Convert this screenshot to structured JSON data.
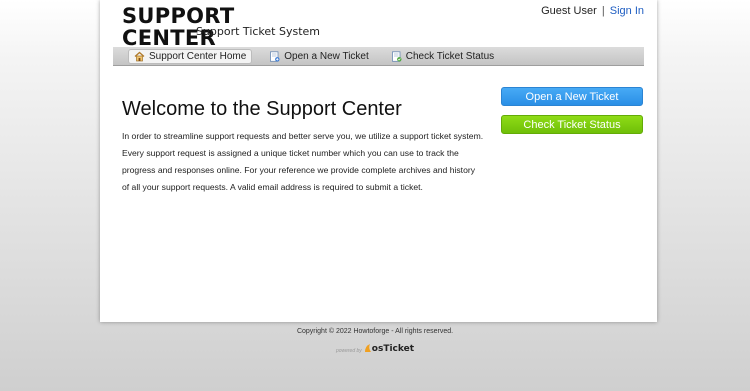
{
  "header": {
    "logo_title": "SUPPORT CENTER",
    "logo_subtitle": "Support Ticket System",
    "user_label": "Guest User",
    "separator": "|",
    "signin_label": "Sign In"
  },
  "nav": {
    "items": [
      {
        "label": "Support Center Home",
        "icon": "home-icon",
        "active": true
      },
      {
        "label": "Open a New Ticket",
        "icon": "new-ticket-icon",
        "active": false
      },
      {
        "label": "Check Ticket Status",
        "icon": "ticket-status-icon",
        "active": false
      }
    ]
  },
  "main": {
    "title": "Welcome to the Support Center",
    "intro": "In order to streamline support requests and better serve you, we utilize a support ticket system. Every support request is assigned a unique ticket number which you can use to track the progress and responses online. For your reference we provide complete archives and history of all your support requests. A valid email address is required to submit a ticket."
  },
  "sidebar": {
    "open_ticket_label": "Open a New Ticket",
    "check_status_label": "Check Ticket Status"
  },
  "footer": {
    "copyright": "Copyright © 2022 Howtoforge - All rights reserved.",
    "powered_by": "powered by",
    "brand": "osTicket"
  },
  "colors": {
    "link": "#1f5ec2",
    "open_button": "#3399ee",
    "check_button": "#77c70c"
  }
}
